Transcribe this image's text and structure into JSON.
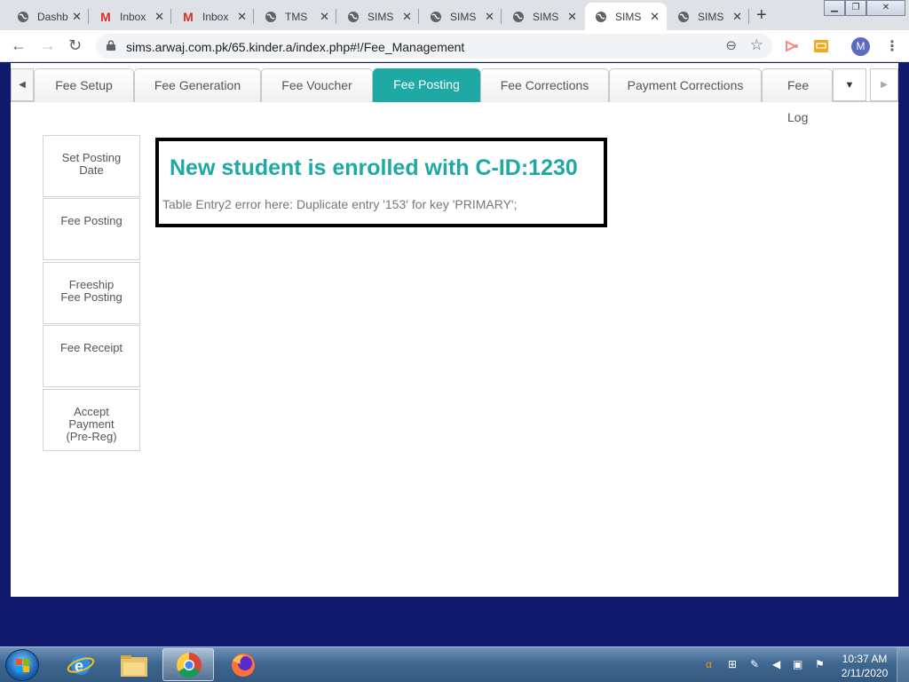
{
  "browser": {
    "tabs": [
      {
        "title": "Dashb",
        "icon": "globe-icon"
      },
      {
        "title": "Inbox",
        "icon": "gmail-icon"
      },
      {
        "title": "Inbox",
        "icon": "gmail-icon"
      },
      {
        "title": "TMS",
        "icon": "globe-icon"
      },
      {
        "title": "SIMS",
        "icon": "globe-icon"
      },
      {
        "title": "SIMS",
        "icon": "globe-icon"
      },
      {
        "title": "SIMS",
        "icon": "globe-icon"
      },
      {
        "title": "SIMS",
        "icon": "globe-icon",
        "active": true
      },
      {
        "title": "SIMS",
        "icon": "globe-icon"
      }
    ],
    "url": "sims.arwaj.com.pk/65.kinder.a/index.php#!/Fee_Management",
    "avatar_letter": "M"
  },
  "app_tabs": [
    {
      "label": "Fee Setup"
    },
    {
      "label": "Fee Generation"
    },
    {
      "label": "Fee Voucher"
    },
    {
      "label": "Fee Posting",
      "active": true
    },
    {
      "label": "Fee Corrections"
    },
    {
      "label": "Payment Corrections"
    },
    {
      "label": "Fee Log"
    }
  ],
  "side_menu": [
    {
      "line1": "Set Posting",
      "line2": "Date",
      "line3": ""
    },
    {
      "line1": "Fee Posting",
      "line2": "",
      "line3": ""
    },
    {
      "line1": "Freeship",
      "line2": "Fee Posting",
      "line3": ""
    },
    {
      "line1": "Fee Receipt",
      "line2": "",
      "line3": ""
    },
    {
      "line1": "Accept",
      "line2": "Payment",
      "line3": "(Pre-Reg)"
    }
  ],
  "message": {
    "title": "New student is enrolled with C-ID:1230",
    "error": "Table Entry2 error here: Duplicate entry '153' for key 'PRIMARY';"
  },
  "taskbar": {
    "time": "10:37 AM",
    "date": "2/11/2020"
  },
  "colors": {
    "accent": "#1fa9a5",
    "desktop": "#10196b"
  }
}
